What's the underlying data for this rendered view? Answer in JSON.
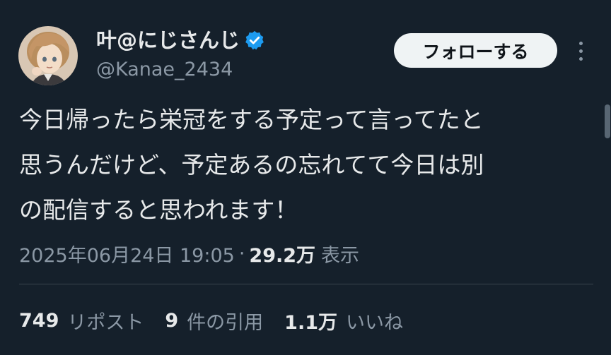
{
  "author": {
    "display_name": "叶@にじさんじ",
    "handle": "@Kanae_2434",
    "verified_icon": "verified-badge-icon",
    "avatar_icon": "avatar-portrait"
  },
  "actions": {
    "follow_label": "フォローする",
    "more_icon": "more-options-icon"
  },
  "tweet": {
    "lines": [
      "今日帰ったら栄冠をする予定って言ってたと",
      "思うんだけど、予定あるの忘れてて今日は別",
      "の配信すると思われます！"
    ]
  },
  "meta": {
    "datetime": "2025年06月24日 19:05",
    "separator": "·",
    "views_count": "29.2万",
    "views_label": "表示"
  },
  "stats": {
    "reposts_count": "749",
    "reposts_label": "リポスト",
    "quotes_count": "9",
    "quotes_label": "件の引用",
    "likes_count": "1.1万",
    "likes_label": "いいね"
  },
  "colors": {
    "background": "#15202b",
    "text_primary": "#e7e9ea",
    "text_secondary": "#8b98a5",
    "verified_blue": "#1d9bf0",
    "follow_button_bg": "#eff3f4",
    "divider": "#38444d"
  }
}
